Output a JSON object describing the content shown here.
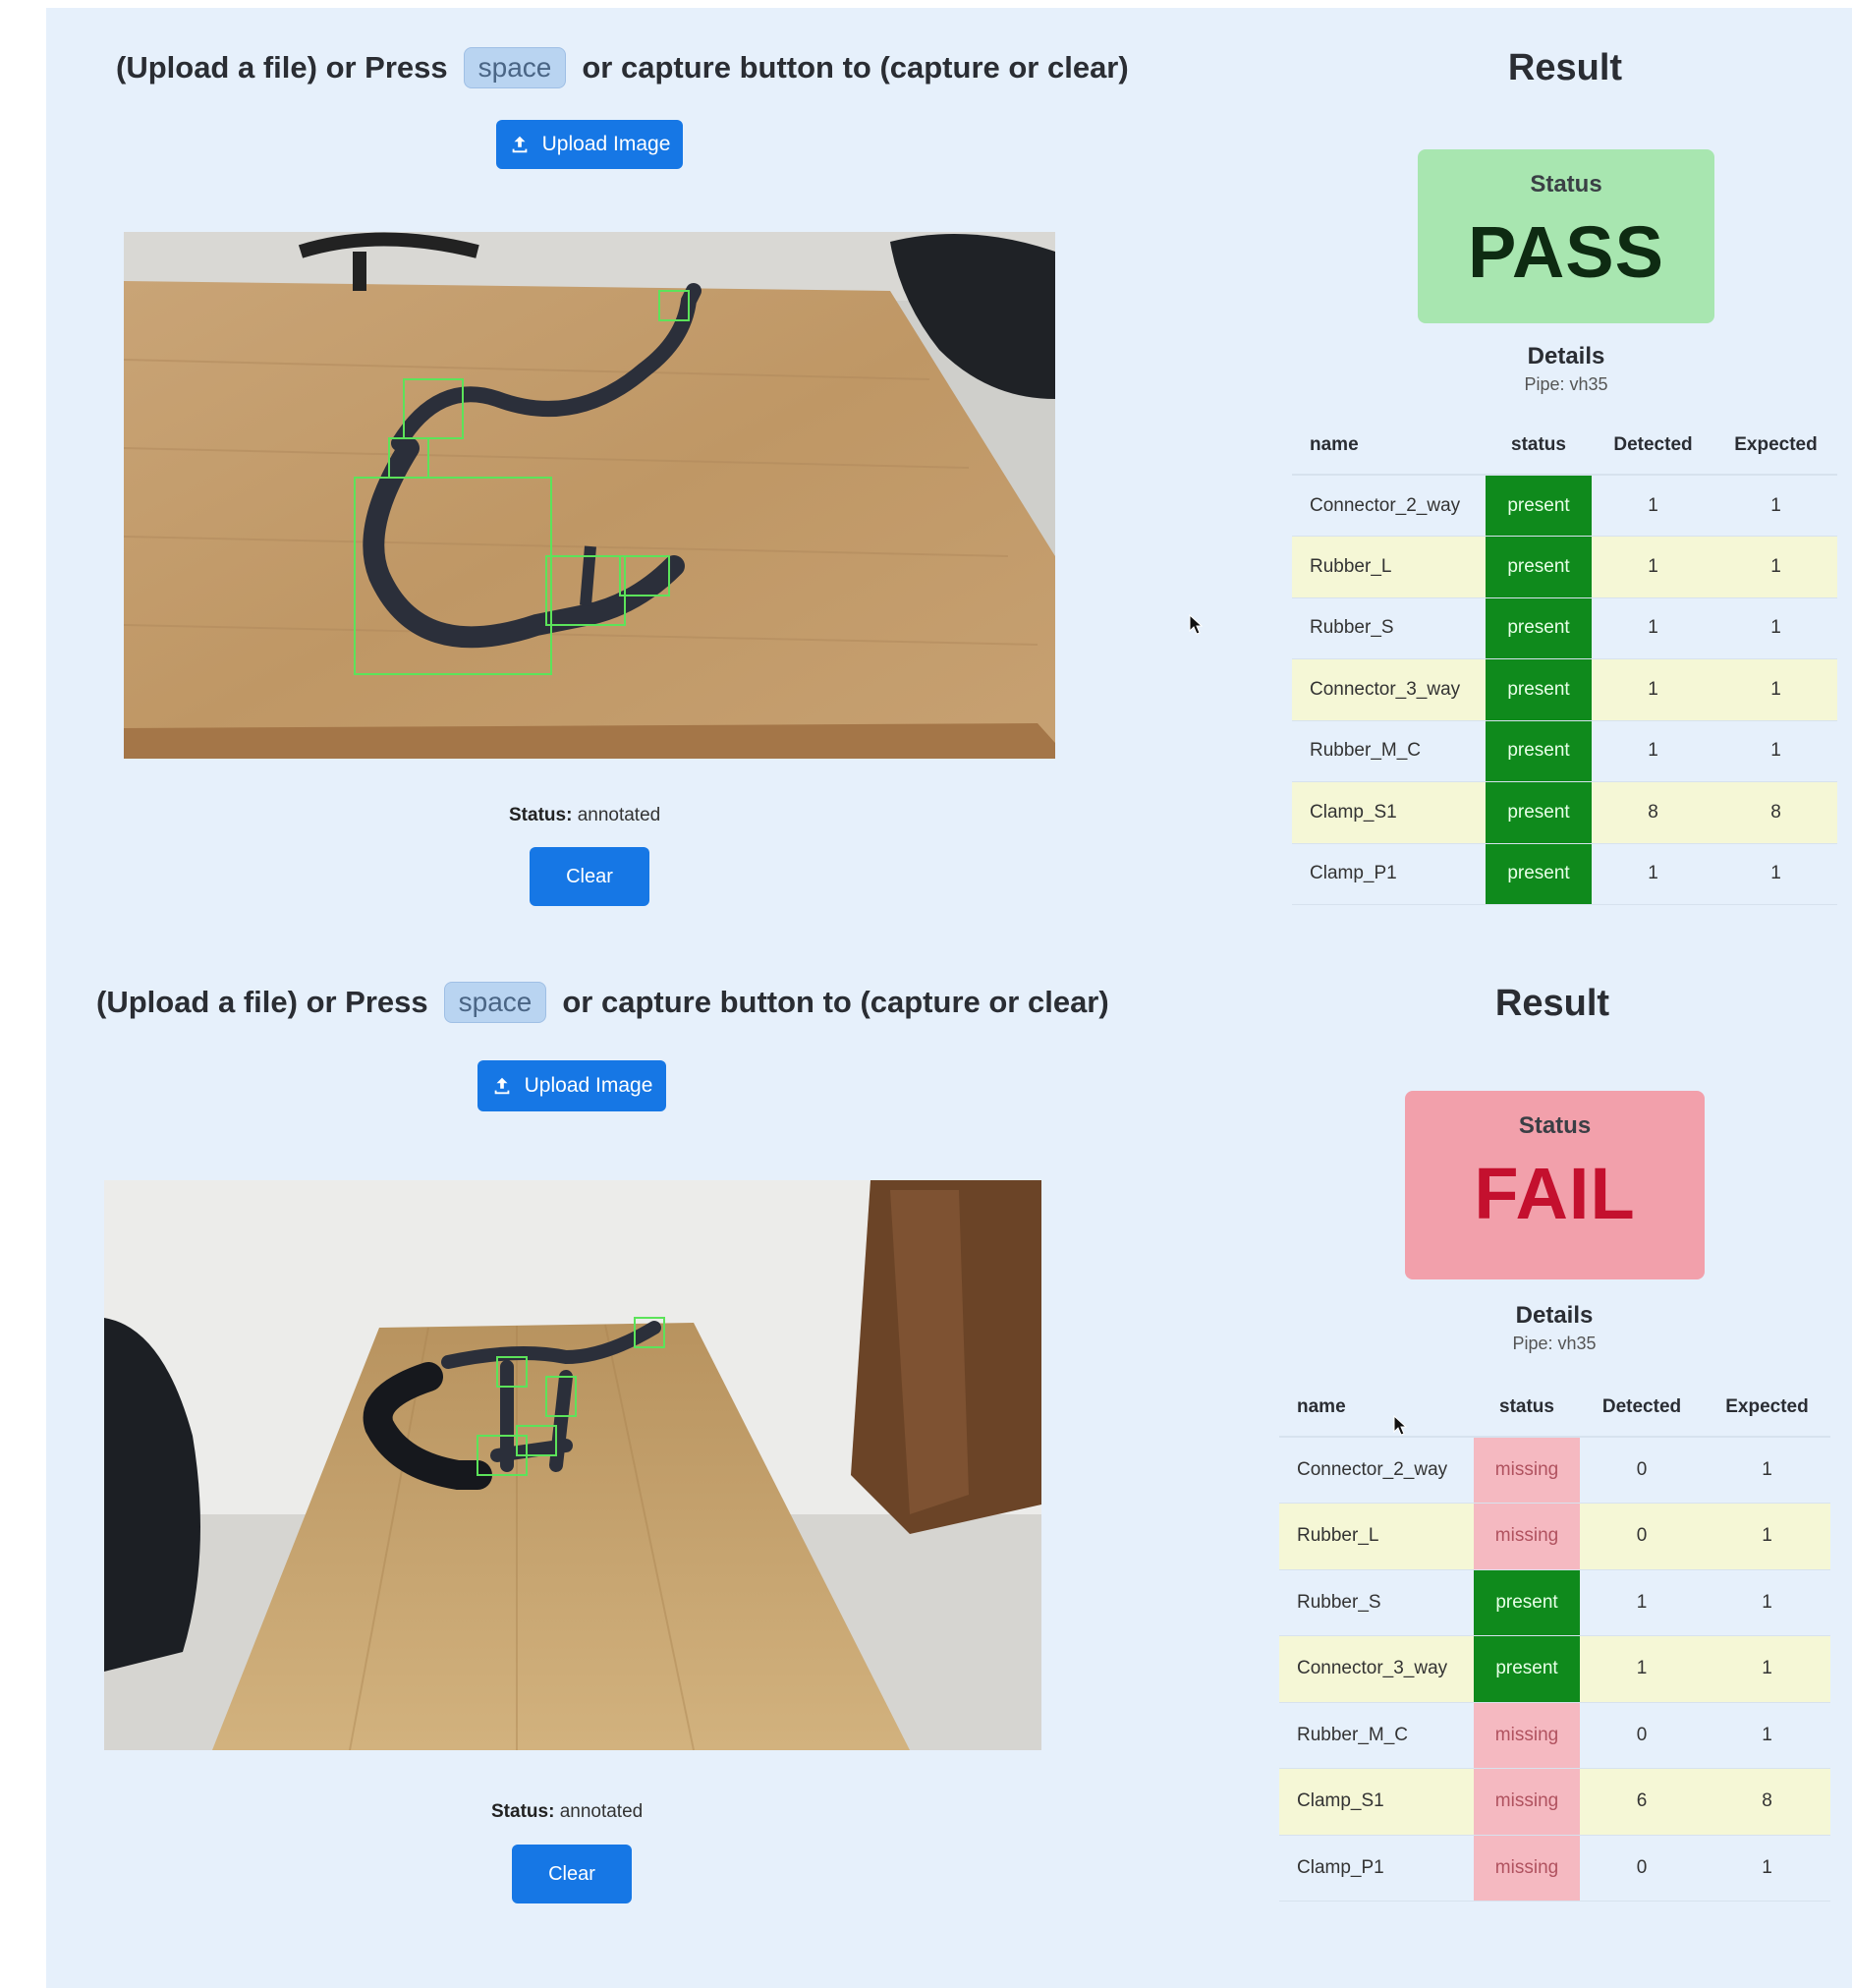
{
  "instruction": {
    "before": "(Upload a file) or Press",
    "key": "space",
    "after": "or capture button to (capture or clear)"
  },
  "upload_label": "Upload Image",
  "status_prefix": "Status:",
  "clear_label": "Clear",
  "result_title": "Result",
  "status_card_label": "Status",
  "details_title": "Details",
  "columns": [
    "name",
    "status",
    "Detected",
    "Expected"
  ],
  "colors": {
    "accent": "#1677e5",
    "present": "#0f8a1c",
    "missing": "#f5b9c1",
    "pass_bg": "#a8e6b0",
    "fail_bg": "#f2a0ab",
    "fail_text": "#c4102e"
  },
  "panels": [
    {
      "image_status": "annotated",
      "result": "PASS",
      "pipe": "Pipe: vh35",
      "rows": [
        {
          "name": "Connector_2_way",
          "status": "present",
          "detected": "1",
          "expected": "1"
        },
        {
          "name": "Rubber_L",
          "status": "present",
          "detected": "1",
          "expected": "1"
        },
        {
          "name": "Rubber_S",
          "status": "present",
          "detected": "1",
          "expected": "1"
        },
        {
          "name": "Connector_3_way",
          "status": "present",
          "detected": "1",
          "expected": "1"
        },
        {
          "name": "Rubber_M_C",
          "status": "present",
          "detected": "1",
          "expected": "1"
        },
        {
          "name": "Clamp_S1",
          "status": "present",
          "detected": "8",
          "expected": "8"
        },
        {
          "name": "Clamp_P1",
          "status": "present",
          "detected": "1",
          "expected": "1"
        }
      ]
    },
    {
      "image_status": "annotated",
      "result": "FAIL",
      "pipe": "Pipe: vh35",
      "rows": [
        {
          "name": "Connector_2_way",
          "status": "missing",
          "detected": "0",
          "expected": "1"
        },
        {
          "name": "Rubber_L",
          "status": "missing",
          "detected": "0",
          "expected": "1"
        },
        {
          "name": "Rubber_S",
          "status": "present",
          "detected": "1",
          "expected": "1"
        },
        {
          "name": "Connector_3_way",
          "status": "present",
          "detected": "1",
          "expected": "1"
        },
        {
          "name": "Rubber_M_C",
          "status": "missing",
          "detected": "0",
          "expected": "1"
        },
        {
          "name": "Clamp_S1",
          "status": "missing",
          "detected": "6",
          "expected": "8"
        },
        {
          "name": "Clamp_P1",
          "status": "missing",
          "detected": "0",
          "expected": "1"
        }
      ]
    }
  ]
}
